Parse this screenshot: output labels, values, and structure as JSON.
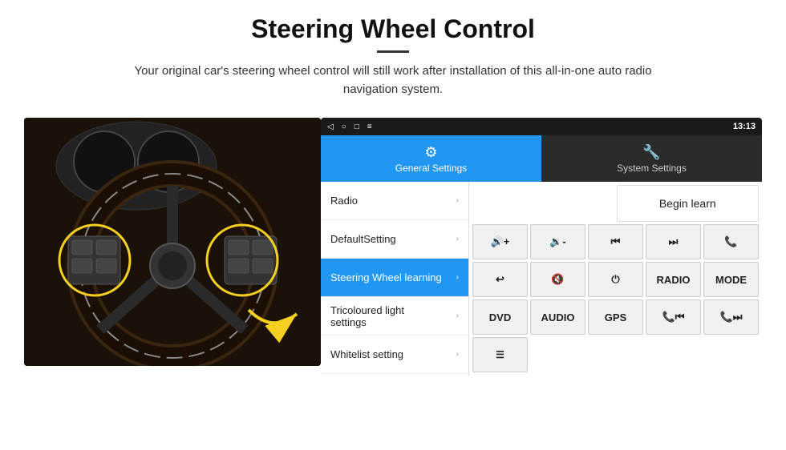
{
  "header": {
    "title": "Steering Wheel Control",
    "subtitle": "Your original car's steering wheel control will still work after installation of this all-in-one auto radio navigation system."
  },
  "tabs": {
    "general": "General Settings",
    "system": "System Settings"
  },
  "status_bar": {
    "time": "13:13",
    "icons": [
      "◁",
      "○",
      "□",
      "≡"
    ]
  },
  "menu": {
    "items": [
      {
        "label": "Radio",
        "active": false
      },
      {
        "label": "DefaultSetting",
        "active": false
      },
      {
        "label": "Steering Wheel learning",
        "active": true
      },
      {
        "label": "Tricoloured light settings",
        "active": false
      },
      {
        "label": "Whitelist setting",
        "active": false
      }
    ]
  },
  "controls": {
    "begin_learn": "Begin learn",
    "row1": [
      "Vol+",
      "Vol-",
      "⏮",
      "⏭",
      "📞"
    ],
    "row2": [
      "↩",
      "Mute",
      "⏻",
      "RADIO",
      "MODE"
    ],
    "row3": [
      "DVD",
      "AUDIO",
      "GPS",
      "📞⏮",
      "📞⏭"
    ],
    "single": [
      "≡"
    ]
  }
}
